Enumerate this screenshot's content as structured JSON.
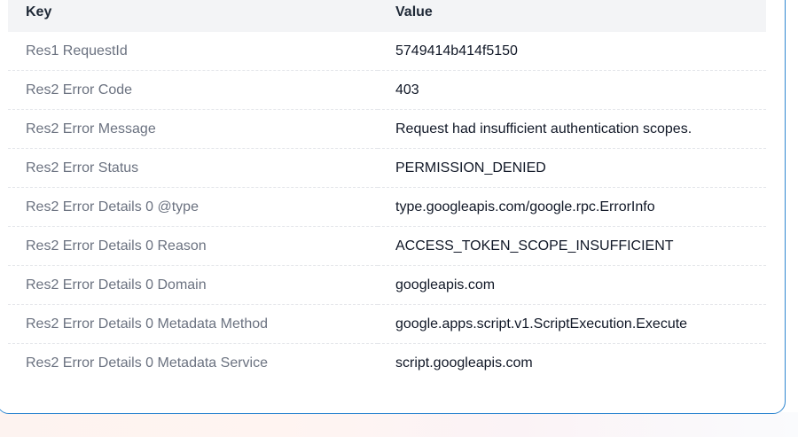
{
  "table": {
    "headers": {
      "key": "Key",
      "value": "Value"
    },
    "rows": [
      {
        "key": "Res1 RequestId",
        "value": "5749414b414f5150"
      },
      {
        "key": "Res2 Error Code",
        "value": "403"
      },
      {
        "key": "Res2 Error Message",
        "value": "Request had insufficient authentication scopes."
      },
      {
        "key": "Res2 Error Status",
        "value": "PERMISSION_DENIED"
      },
      {
        "key": "Res2 Error Details 0 @type",
        "value": "type.googleapis.com/google.rpc.ErrorInfo"
      },
      {
        "key": "Res2 Error Details 0 Reason",
        "value": "ACCESS_TOKEN_SCOPE_INSUFFICIENT"
      },
      {
        "key": "Res2 Error Details 0 Domain",
        "value": "googleapis.com"
      },
      {
        "key": "Res2 Error Details 0 Metadata Method",
        "value": "google.apps.script.v1.ScriptExecution.Execute"
      },
      {
        "key": "Res2 Error Details 0 Metadata Service",
        "value": "script.googleapis.com"
      }
    ]
  },
  "colors": {
    "panel_border": "#2f87d0",
    "header_bg": "#f3f4f6",
    "key_text": "#6b7280",
    "value_text": "#111827"
  }
}
